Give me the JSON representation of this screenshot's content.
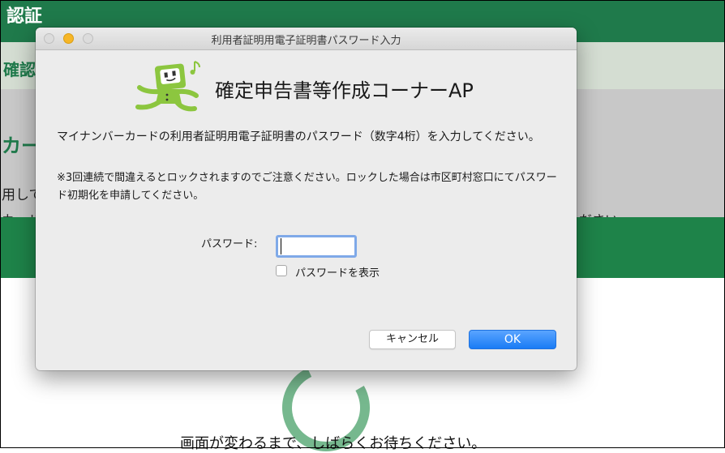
{
  "background": {
    "header_title": "認証",
    "band_title": "確認",
    "section_heading": "カー",
    "line1": "用して",
    "line2_left": "カード",
    "line2_right": "ださい",
    "waiting_text": "画面が変わるまで、しばらくお待ちください。",
    "colors": {
      "header": "#1f7a4b",
      "band": "#d4ddd2",
      "overlay_gray": "#c8c8c8",
      "green": "#1e8349",
      "spinner": "#76b88e"
    }
  },
  "dialog": {
    "window_title": "利用者証明用電子証明書パスワード入力",
    "app_title": "確定申告書等作成コーナーAP",
    "message": "マイナンバーカードの利用者証明用電子証明書のパスワード（数字4桁）を入力してください。",
    "warning": "※3回連続で間違えるとロックされますのでご注意ください。ロックした場合は市区町村窓口にてパスワード初期化を申請してください。",
    "password_label": "パスワード:",
    "password_value": "",
    "show_password_label": "パスワードを表示",
    "show_password_checked": false,
    "cancel_label": "キャンセル",
    "ok_label": "OK",
    "icons": {
      "mascot": "mascot-icon",
      "close": "close-icon",
      "minimize": "minimize-icon",
      "maximize": "maximize-icon"
    },
    "colors": {
      "ok_button": "#1a7bf5",
      "mascot": "#8cc63f",
      "focus_ring": "#7fa9e8"
    }
  }
}
